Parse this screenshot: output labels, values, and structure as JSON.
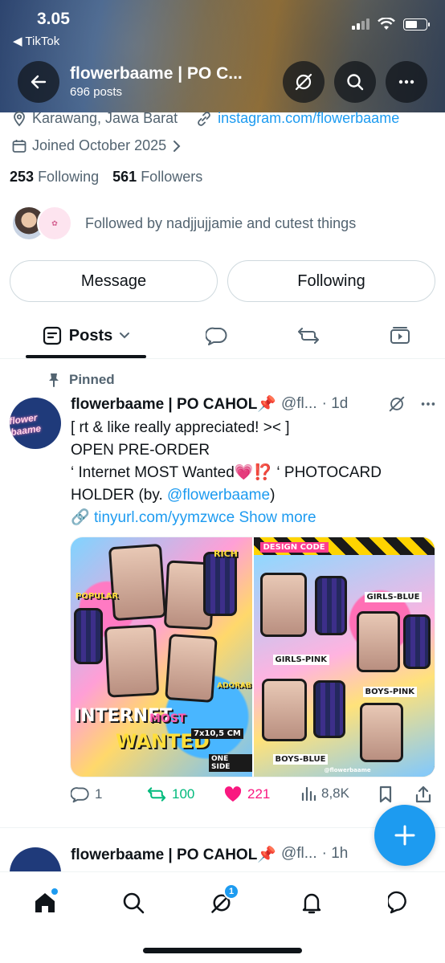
{
  "status_bar": {
    "time": "3.05",
    "back_app": "◀ TikTok"
  },
  "header": {
    "title": "flowerbaame | PO C...",
    "post_count": "696 posts"
  },
  "profile": {
    "location": "Karawang, Jawa Barat",
    "website": "instagram.com/flowerbaame",
    "joined": "Joined October 2025",
    "following_count": "253",
    "following_label": "Following",
    "followers_count": "561",
    "followers_label": "Followers",
    "followed_by": "Followed by nadjjujjamie and cutest things",
    "message_button": "Message",
    "following_button": "Following"
  },
  "tabs": {
    "posts": "Posts"
  },
  "post": {
    "pinned_label": "Pinned",
    "author_name": "flowerbaame | PO CAHOL📌",
    "author_handle": "@fl...",
    "time": "· 1d",
    "lines": [
      "[ rt & like really appreciated! >< ]",
      "OPEN PRE-ORDER",
      "‘ Internet MOST Wanted💗⁉️ ‘ PHOTOCARD",
      "HOLDER (by. @flowerbaame)"
    ],
    "link_emoji": "🔗",
    "link": "tinyurl.com/yymzwce",
    "show_more": "Show more",
    "replies": "1",
    "reposts": "100",
    "likes": "221",
    "views": "8,8K",
    "media_left": {
      "sticker_main": "INTERNET",
      "sticker_most": "MOST",
      "sticker_wanted": "WANTED",
      "size": "7x10,5 CM",
      "one_side": "ONE SIDE",
      "popular": "POPULAR",
      "rich": "RICH",
      "adorable": "ADORABLE"
    },
    "media_right": {
      "design_code": "DESIGN CODE",
      "girls_pink": "GIRLS-PINK",
      "girls_blue": "GIRLS-BLUE",
      "boys_pink": "BOYS-PINK",
      "boys_blue": "BOYS-BLUE",
      "credit": "@flowerbaame"
    }
  },
  "post2": {
    "author_name": "flowerbaame | PO CAHOL📌",
    "author_handle": "@fl...",
    "time": "· 1h"
  },
  "nav": {
    "grok_badge": "1"
  }
}
